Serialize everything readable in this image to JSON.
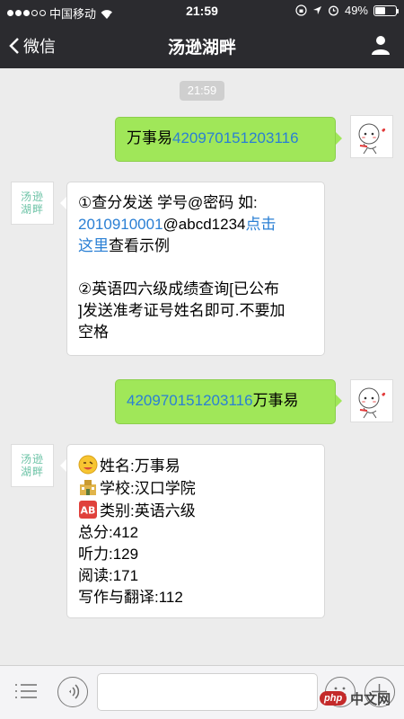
{
  "status_bar": {
    "carrier": "中国移动",
    "time": "21:59",
    "battery": "49%",
    "battery_level": 0.49
  },
  "nav": {
    "back_label": "微信",
    "title": "汤逊湖畔"
  },
  "chat": {
    "timestamp": "21:59",
    "avatar_text": [
      "汤逊",
      "湖畔"
    ],
    "messages": [
      {
        "from": "me",
        "text": "万事易",
        "link": "42097015120311​6"
      },
      {
        "from": "bot",
        "line1": "①查分发送 学号@密码 如:",
        "link_number": "2010910001",
        "line2_rest": "@abcd1234",
        "link_click": "点击",
        "link_here": "这里",
        "line3_rest": "查看示例",
        "line4": "②英语四六级成绩查询[已公布",
        "line5": "]发送准考证号姓名即可.不要加",
        "line6": "空格"
      },
      {
        "from": "me",
        "link": "420970151203116",
        "text": "万事易"
      },
      {
        "from": "bot",
        "name_line": "姓名:万事易",
        "school_line": "学校:汉口学院",
        "type_line": "类别:英语六级",
        "total_line": "总分:412",
        "listening_line": "听力:129",
        "reading_line": "阅读:171",
        "writing_line": "写作与翻译:112"
      }
    ]
  },
  "watermark": {
    "badge": "php",
    "text": "中文网"
  }
}
